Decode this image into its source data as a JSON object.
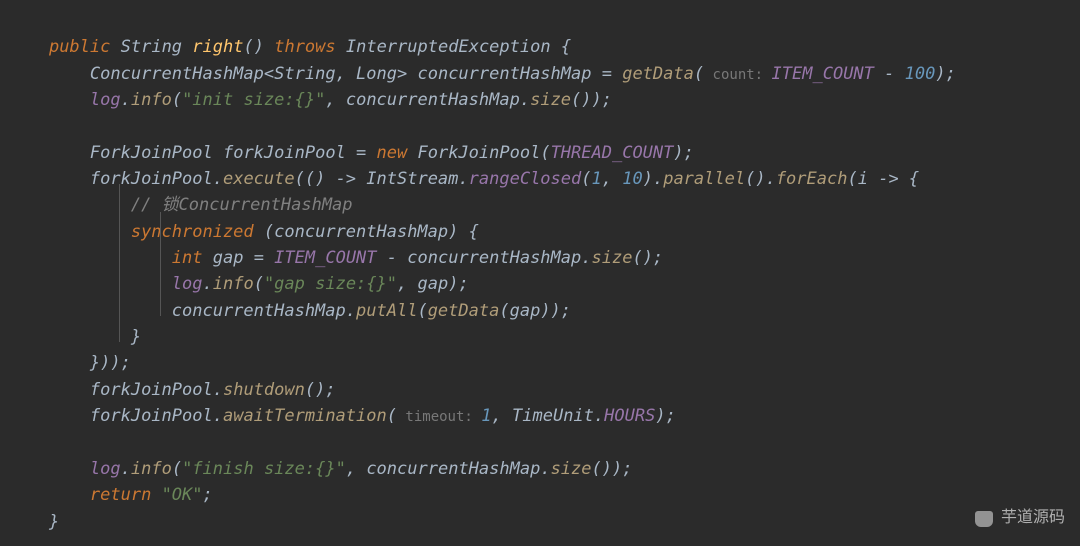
{
  "code": {
    "l1": {
      "kw1": "public",
      "type1": "String",
      "name": "right",
      "p1": "()",
      "kw2": "throws",
      "exc": "InterruptedException",
      "p2": " {"
    },
    "l2": {
      "type1": "ConcurrentHashMap",
      "p1": "<",
      "type2": "String",
      "p2": ", ",
      "type3": "Long",
      "p3": "> ",
      "var1": "concurrentHashMap",
      "op": " = ",
      "fn": "getData",
      "p4": "(",
      "hint": " count: ",
      "const1": "ITEM_COUNT",
      "op2": " - ",
      "num": "100",
      "p5": ");"
    },
    "l3": {
      "var1": "log",
      "p1": ".",
      "fn": "info",
      "p2": "(",
      "str": "\"init size:{}\"",
      "p3": ", ",
      "var2": "concurrentHashMap",
      "p4": ".",
      "fn2": "size",
      "p5": "());"
    },
    "l4": "",
    "l5": {
      "type1": "ForkJoinPool",
      "var1": "forkJoinPool",
      "op": " = ",
      "kw": "new",
      "type2": "ForkJoinPool",
      "p1": "(",
      "const1": "THREAD_COUNT",
      "p2": ");"
    },
    "l6": {
      "var1": "forkJoinPool",
      "p1": ".",
      "fn": "execute",
      "p2": "(() -> ",
      "type1": "IntStream",
      "p3": ".",
      "fn2": "rangeClosed",
      "p4": "(",
      "n1": "1",
      "p5": ", ",
      "n2": "10",
      "p6": ").",
      "fn3": "parallel",
      "p7": "().",
      "fn4": "forEach",
      "p8": "(",
      "var2": "i",
      "p9": " -> {"
    },
    "l7": {
      "comment": "// 锁ConcurrentHashMap"
    },
    "l8": {
      "kw": "synchronized",
      "p1": " (",
      "var1": "concurrentHashMap",
      "p2": ") {"
    },
    "l9": {
      "type1": "int",
      "var1": "gap",
      "op": " = ",
      "const1": "ITEM_COUNT",
      "op2": " - ",
      "var2": "concurrentHashMap",
      "p1": ".",
      "fn": "size",
      "p2": "();"
    },
    "l10": {
      "var1": "log",
      "p1": ".",
      "fn": "info",
      "p2": "(",
      "str": "\"gap size:{}\"",
      "p3": ", ",
      "var2": "gap",
      "p4": ");"
    },
    "l11": {
      "var1": "concurrentHashMap",
      "p1": ".",
      "fn": "putAll",
      "p2": "(",
      "fn2": "getData",
      "p3": "(",
      "var2": "gap",
      "p4": "));"
    },
    "l12": {
      "p1": "}"
    },
    "l13": {
      "p1": "}));"
    },
    "l14": {
      "var1": "forkJoinPool",
      "p1": ".",
      "fn": "shutdown",
      "p2": "();"
    },
    "l15": {
      "var1": "forkJoinPool",
      "p1": ".",
      "fn": "awaitTermination",
      "p2": "(",
      "hint": " timeout: ",
      "n1": "1",
      "p3": ", ",
      "type1": "TimeUnit",
      "p4": ".",
      "const1": "HOURS",
      "p5": ");"
    },
    "l16": "",
    "l17": {
      "var1": "log",
      "p1": ".",
      "fn": "info",
      "p2": "(",
      "str": "\"finish size:{}\"",
      "p3": ", ",
      "var2": "concurrentHashMap",
      "p4": ".",
      "fn2": "size",
      "p5": "());"
    },
    "l18": {
      "kw": "return",
      "p1": " ",
      "str": "\"OK\"",
      "p2": ";"
    },
    "l19": {
      "p1": "}"
    }
  },
  "watermark": {
    "text": "芋道源码"
  }
}
